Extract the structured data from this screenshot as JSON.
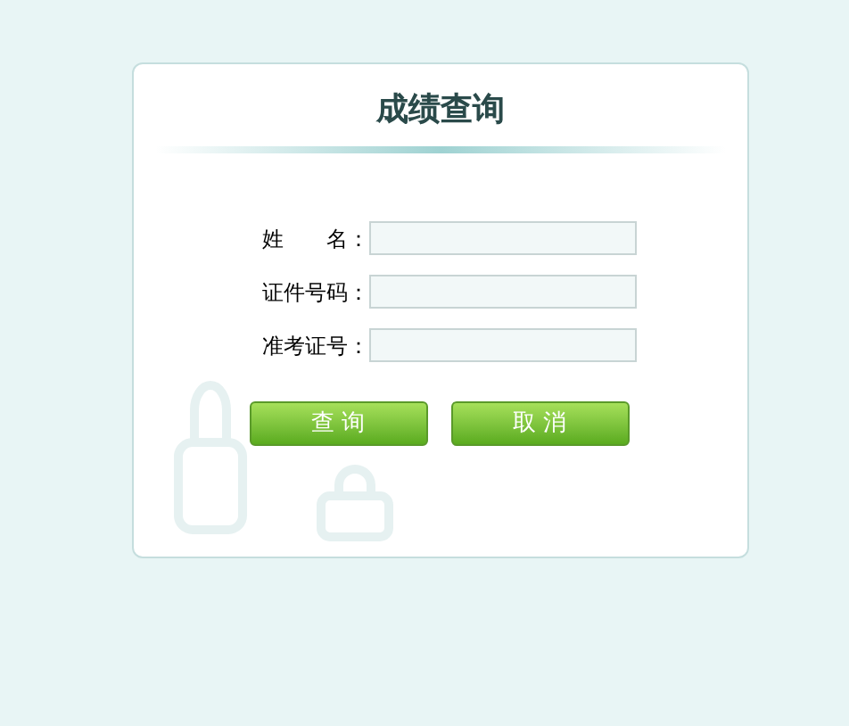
{
  "title": "成绩查询",
  "fields": [
    {
      "label": "姓　　名："
    },
    {
      "label": "证件号码："
    },
    {
      "label": "准考证号："
    }
  ],
  "buttons": [
    "查 询",
    "取 消"
  ]
}
